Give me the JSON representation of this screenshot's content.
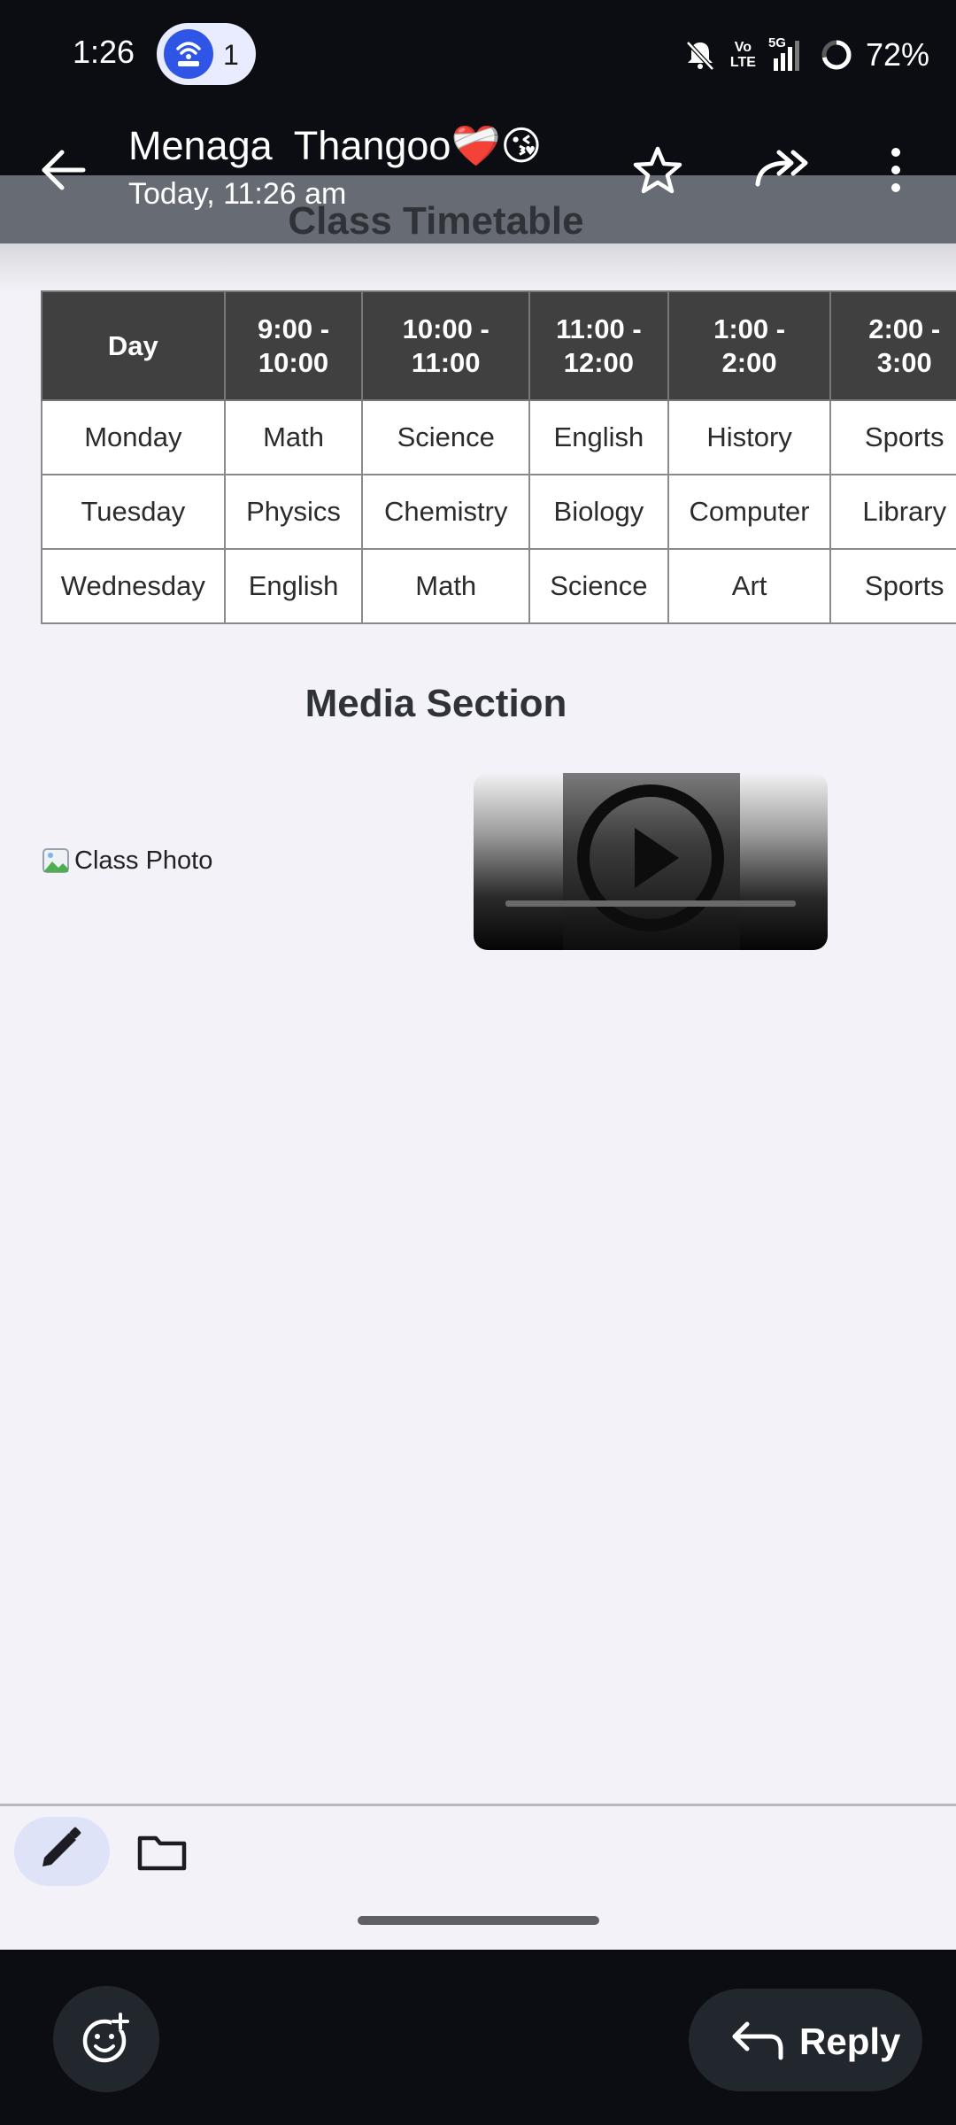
{
  "status_bar": {
    "time": "1:26",
    "hotspot_count": "1",
    "volte_line1": "Vo",
    "volte_line2": "LTE",
    "network": "5G",
    "battery": "72%"
  },
  "app_bar": {
    "contact_name": "Menaga  Thangoo❤️‍🩹😘",
    "message_time": "Today, 11:26 am"
  },
  "document": {
    "title": "Class Timetable",
    "timetable": {
      "headers": [
        "Day",
        "9:00 -\n10:00",
        "10:00 -\n11:00",
        "11:00 -\n12:00",
        "1:00 -\n2:00",
        "2:00 -\n3:00"
      ],
      "rows": [
        [
          "Monday",
          "Math",
          "Science",
          "English",
          "History",
          "Sports"
        ],
        [
          "Tuesday",
          "Physics",
          "Chemistry",
          "Biology",
          "Computer",
          "Library"
        ],
        [
          "Wednesday",
          "English",
          "Math",
          "Science",
          "Art",
          "Sports"
        ]
      ]
    },
    "media_title": "Media Section",
    "photo_alt": "Class Photo"
  },
  "bottom_bar": {
    "reply_label": "Reply"
  },
  "colors": {
    "status_bg": "#0b0d12",
    "header_cell_bg": "#404040",
    "accent_pill": "#dfe3f7",
    "hotspot_blue": "#2f55e6"
  }
}
